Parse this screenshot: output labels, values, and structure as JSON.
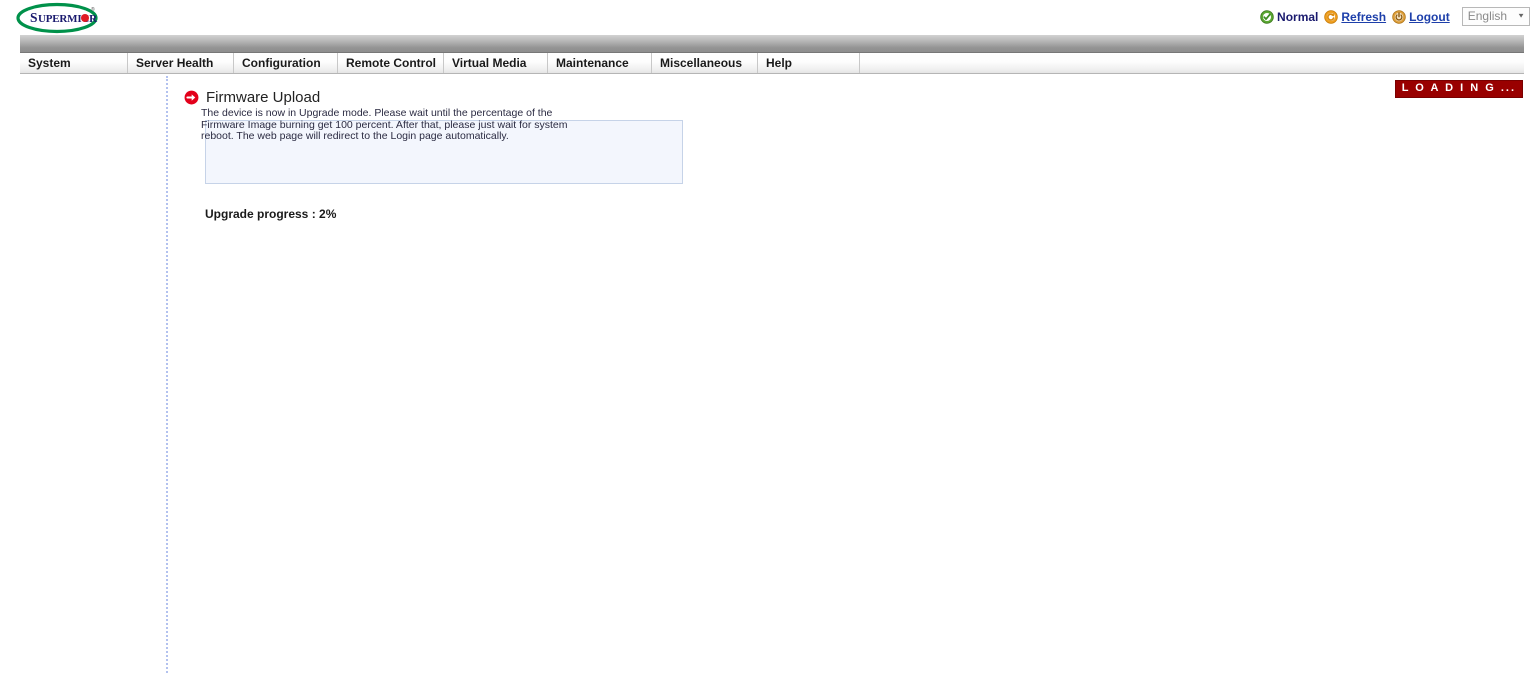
{
  "header": {
    "logo_text": "SUPERMICRO",
    "status": {
      "icon": "green-check-circle-icon",
      "label": "Normal"
    },
    "refresh": {
      "icon": "refresh-circle-icon",
      "label": "Refresh"
    },
    "logout": {
      "icon": "logout-power-icon",
      "label": "Logout"
    },
    "language": {
      "value": "English",
      "caret": "▼"
    }
  },
  "menu": {
    "items": [
      {
        "label": "System"
      },
      {
        "label": "Server Health"
      },
      {
        "label": "Configuration"
      },
      {
        "label": "Remote Control"
      },
      {
        "label": "Virtual Media"
      },
      {
        "label": "Maintenance"
      },
      {
        "label": "Miscellaneous"
      },
      {
        "label": "Help"
      }
    ]
  },
  "page": {
    "title": "Firmware Upload",
    "title_icon": "red-arrow-right-icon",
    "loading_badge": "L O A D I N G ...",
    "message": "The device is now in Upgrade mode. Please wait until the percentage of the Firmware Image burning get 100 percent. After that, please just wait for system reboot. The web page will redirect to the Login page automatically.",
    "progress_label": "Upgrade progress : 2%",
    "progress_percent": 2
  },
  "colors": {
    "brand_green": "#00914a",
    "brand_navy": "#1a1a6e",
    "brand_red": "#e01b24",
    "loading_red": "#990000",
    "link_blue": "#1d3faa",
    "msg_bg": "#f3f6fd",
    "msg_border": "#c6d3e8",
    "dotted_divider": "#b3c2ef"
  }
}
